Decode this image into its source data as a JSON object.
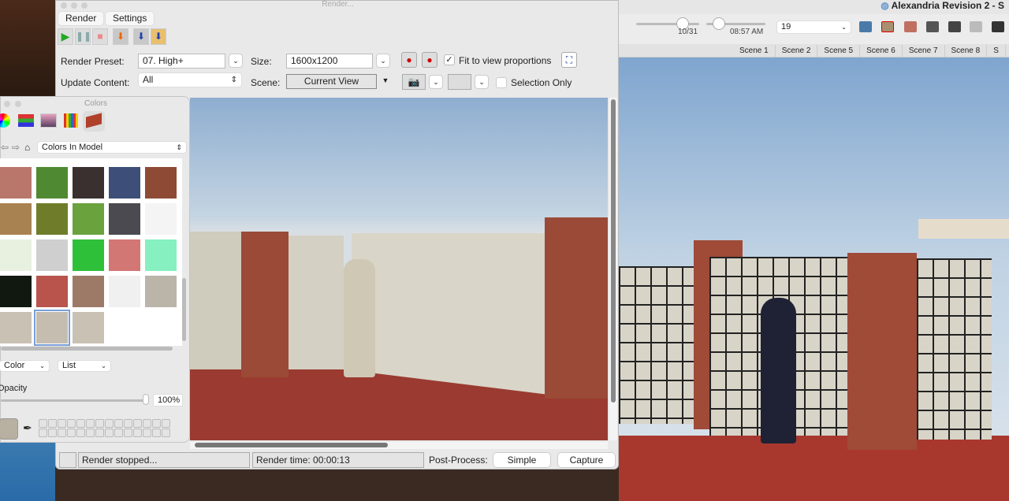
{
  "sketchup": {
    "title": "Alexandria Revision 2 - S",
    "date": "10/31",
    "time": "08:57 AM",
    "layer_value": "19",
    "scenes": [
      "Scene 1",
      "Scene 2",
      "Scene 5",
      "Scene 6",
      "Scene 7",
      "Scene 8",
      "S"
    ]
  },
  "render_window": {
    "title": "Render...",
    "tabs": [
      "Render",
      "Settings"
    ],
    "toolbar": [
      "play",
      "pause",
      "stop",
      "save-render",
      "export",
      "open-folder"
    ],
    "preset_label": "Render Preset:",
    "preset_value": "07. High+",
    "size_label": "Size:",
    "size_value": "1600x1200",
    "fit_label": "Fit to view proportions",
    "fit_checked": true,
    "update_label": "Update Content:",
    "update_value": "All",
    "scene_label": "Scene:",
    "scene_value": "Current View",
    "selection_label": "Selection Only",
    "selection_checked": false,
    "status": "Render stopped...",
    "render_time": "Render time: 00:00:13",
    "postprocess_label": "Post-Process:",
    "simple_button": "Simple",
    "capture_button": "Capture"
  },
  "colors_panel": {
    "title": "Colors",
    "source": "Colors In Model",
    "mode": "Color",
    "view": "List",
    "opacity_label": "Opacity",
    "opacity_value": "100%",
    "opacity": 1.0,
    "swatches": [
      "#b9766a",
      "#4f8a32",
      "#3a3030",
      "#3d4f78",
      "#8f4a36",
      "#a88250",
      "#6f7d2a",
      "#6aa23d",
      "#4a4a50",
      "#f4f4f4",
      "#e8f0e0",
      "#cfcfcf",
      "#2fc03a",
      "#d37774",
      "#86f0c0",
      "#101810",
      "#b9544c",
      "#9d7a68",
      "#f0f0f0",
      "#bbb4a8",
      "#c9c1b4",
      "#c4bdb0",
      "#c9c1b4",
      "#ffffff"
    ],
    "selected_swatch": 21,
    "current_color": "#b8b0a0"
  }
}
